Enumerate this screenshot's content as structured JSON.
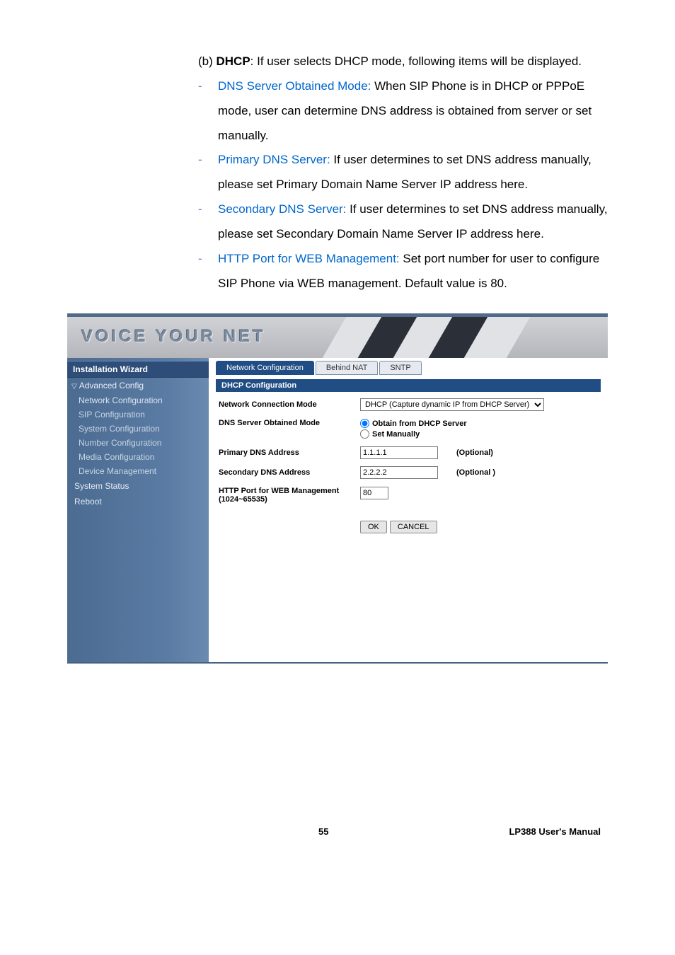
{
  "doc": {
    "b_prefix": "(b) ",
    "b_bold": "DHCP",
    "b_text": ": If user selects DHCP mode, following items will be displayed.",
    "items": [
      {
        "blue": "DNS Server Obtained Mode: ",
        "text": "When SIP Phone is in DHCP or PPPoE mode, user can determine DNS address is obtained from server or set manually."
      },
      {
        "blue": "Primary DNS Server: ",
        "text": "If user determines to set DNS address manually, please set Primary Domain Name Server IP address here."
      },
      {
        "blue": "Secondary DNS Server: ",
        "text": "If user determines to set DNS address manually, please set Secondary Domain Name Server IP address here."
      },
      {
        "blue": "HTTP Port for WEB Management: ",
        "text": "Set port number for user to configure SIP Phone via WEB management. Default value is 80."
      }
    ]
  },
  "banner_title": "VOICE YOUR NET",
  "sidebar": {
    "wizard": "Installation Wizard",
    "adv": "Advanced Config",
    "links": [
      "Network Configuration",
      "SIP Configuration",
      "System Configuration",
      "Number Configuration",
      "Media Configuration",
      "Device Management"
    ],
    "status": "System Status",
    "reboot": "Reboot"
  },
  "tabs": {
    "t1": "Network Configuration",
    "t2": "Behind NAT",
    "t3": "SNTP"
  },
  "panel_title": "DHCP Configuration",
  "form": {
    "mode_label": "Network Connection Mode",
    "mode_value": "DHCP (Capture dynamic IP from DHCP Server)",
    "dns_mode_label": "DNS Server Obtained Mode",
    "dns_r1": "Obtain from DHCP Server",
    "dns_r2": "Set Manually",
    "pdns_label": "Primary DNS Address",
    "pdns_value": "1.1.1.1",
    "pdns_opt": "(Optional)",
    "sdns_label": "Secondary DNS Address",
    "sdns_value": "2.2.2.2",
    "sdns_opt": "(Optional )",
    "http_label1": "HTTP Port for WEB Management",
    "http_label2": "(1024~65535)",
    "http_value": "80",
    "ok": "OK",
    "cancel": "CANCEL"
  },
  "footer": {
    "page": "55",
    "manual": "LP388  User's  Manual"
  }
}
